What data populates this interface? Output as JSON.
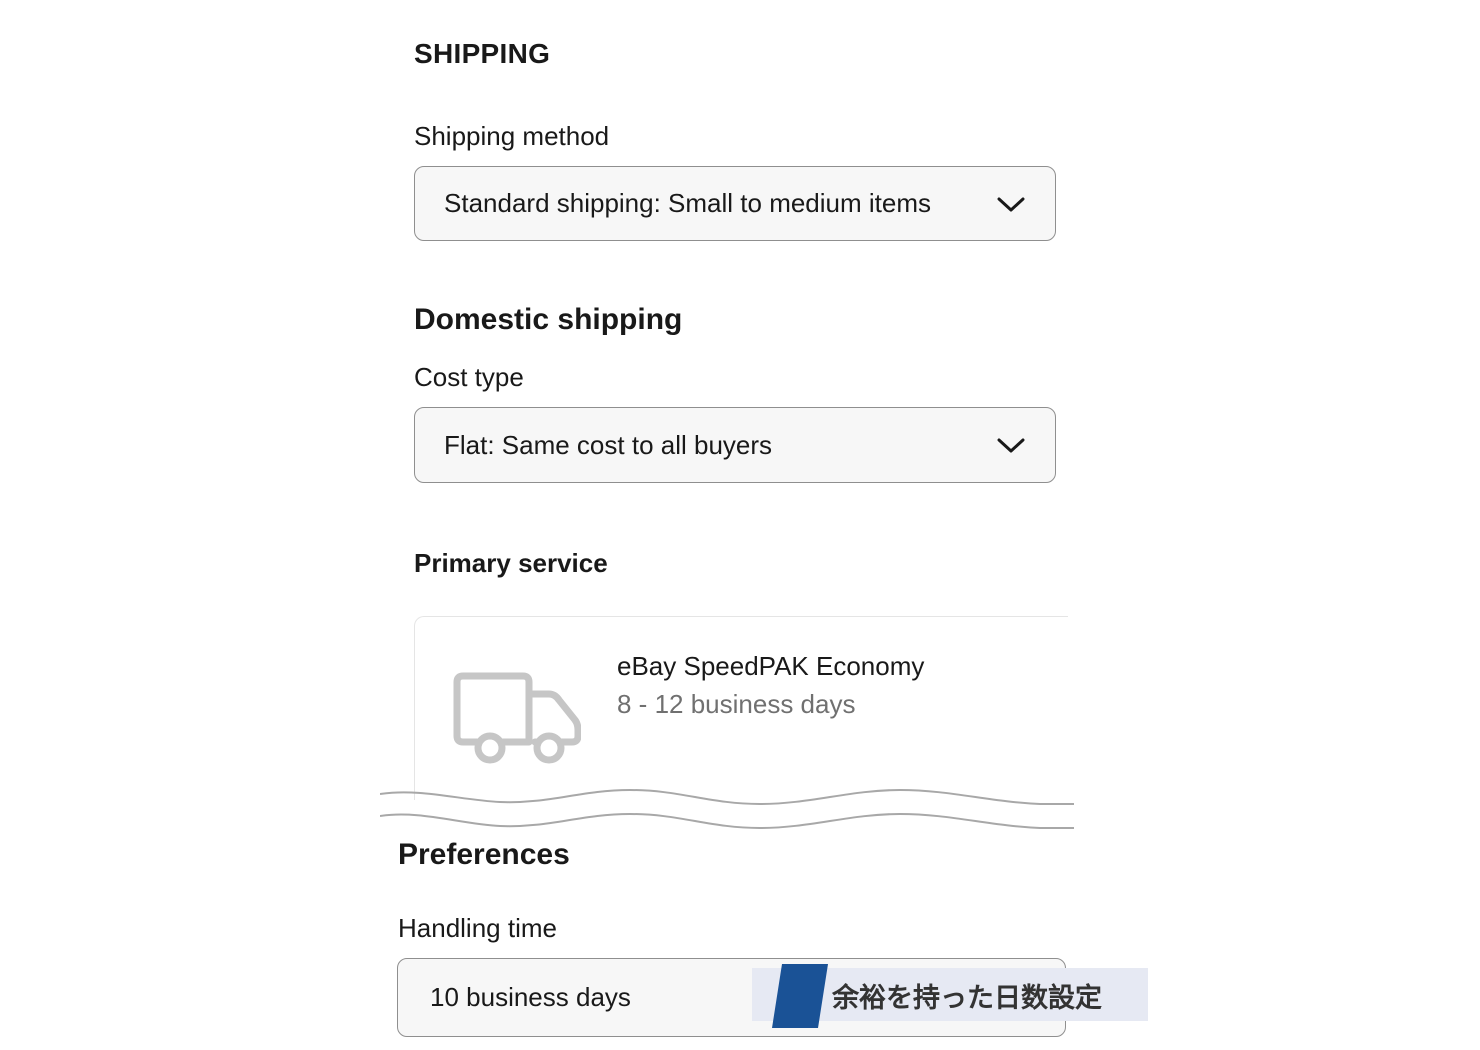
{
  "shipping": {
    "title": "SHIPPING",
    "method_label": "Shipping method",
    "method_value": "Standard shipping: Small to medium items"
  },
  "domestic": {
    "title": "Domestic shipping",
    "cost_type_label": "Cost type",
    "cost_type_value": "Flat: Same cost to all buyers",
    "primary_service_title": "Primary service",
    "service": {
      "icon": "truck-icon",
      "name": "eBay SpeedPAK Economy",
      "days": "8 - 12 business days"
    }
  },
  "preferences": {
    "title": "Preferences",
    "handling_label": "Handling time",
    "handling_value": "10 business days"
  },
  "annotation": {
    "text": "余裕を持った日数設定",
    "accent_color": "#1a5296"
  },
  "colors": {
    "field_bg": "#f7f7f7",
    "field_border": "#8f8f8f",
    "muted_text": "#707070"
  }
}
